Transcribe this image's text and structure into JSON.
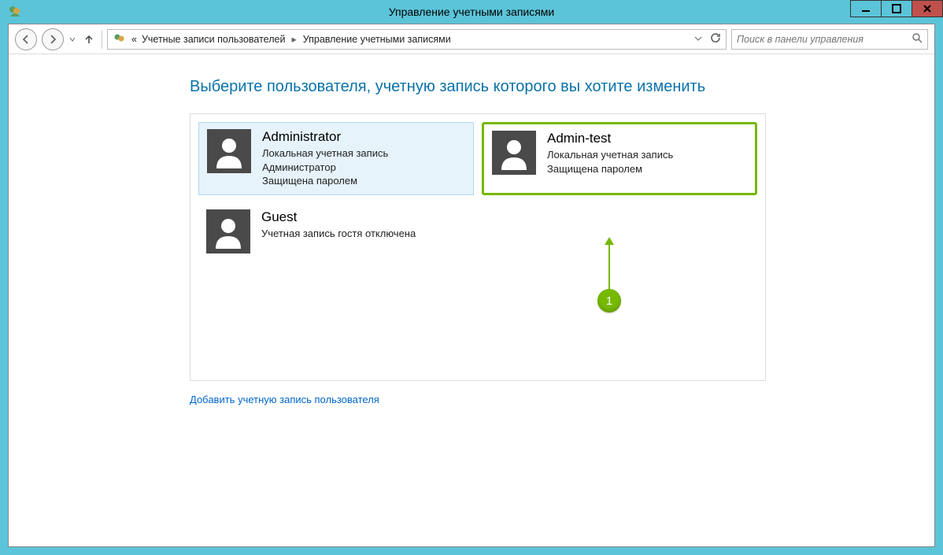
{
  "window": {
    "title": "Управление учетными записями"
  },
  "nav": {
    "breadcrumb_prefix": "«",
    "crumb1": "Учетные записи пользователей",
    "crumb2": "Управление учетными записями"
  },
  "search": {
    "placeholder": "Поиск в панели управления"
  },
  "main": {
    "heading": "Выберите пользователя, учетную запись которого вы хотите изменить",
    "add_link": "Добавить учетную запись пользователя"
  },
  "accounts": [
    {
      "name": "Administrator",
      "line1": "Локальная учетная запись",
      "line2": "Администратор",
      "line3": "Защищена паролем"
    },
    {
      "name": "Admin-test",
      "line1": "Локальная учетная запись",
      "line2": "Защищена паролем",
      "line3": ""
    },
    {
      "name": "Guest",
      "line1": "Учетная запись гостя отключена",
      "line2": "",
      "line3": ""
    }
  ],
  "callout": {
    "number": "1"
  }
}
